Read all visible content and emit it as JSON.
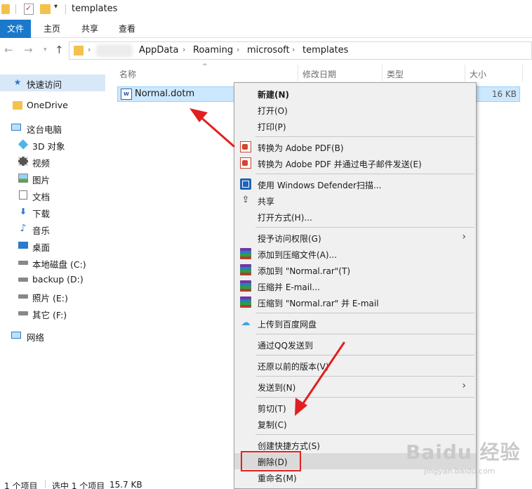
{
  "window": {
    "title": "templates"
  },
  "ribbon": {
    "tabs": [
      "文件",
      "主页",
      "共享",
      "查看"
    ]
  },
  "address": {
    "crumbs": [
      "AppData",
      "Roaming",
      "microsoft",
      "templates"
    ],
    "separator": "›"
  },
  "nav_pane": {
    "items": [
      {
        "label": "快速访问",
        "icon": "star-icon",
        "selected": true
      },
      {
        "label": "OneDrive",
        "icon": "folder-icon"
      },
      {
        "label": "这台电脑",
        "icon": "computer-icon"
      },
      {
        "label": "3D 对象",
        "icon": "cube-icon"
      },
      {
        "label": "视频",
        "icon": "film-icon"
      },
      {
        "label": "图片",
        "icon": "picture-icon"
      },
      {
        "label": "文档",
        "icon": "document-icon"
      },
      {
        "label": "下载",
        "icon": "download-icon"
      },
      {
        "label": "音乐",
        "icon": "music-icon"
      },
      {
        "label": "桌面",
        "icon": "desktop-icon"
      },
      {
        "label": "本地磁盘 (C:)",
        "icon": "drive-icon"
      },
      {
        "label": "backup (D:)",
        "icon": "drive-icon"
      },
      {
        "label": "照片 (E:)",
        "icon": "drive-icon"
      },
      {
        "label": "其它 (F:)",
        "icon": "drive-icon"
      },
      {
        "label": "网络",
        "icon": "network-icon"
      }
    ]
  },
  "columns": {
    "name": "名称",
    "modified": "修改日期",
    "type": "类型",
    "size": "大小"
  },
  "file": {
    "name": "Normal.dotm",
    "size": "16 KB",
    "icon_text": "W"
  },
  "context_menu": {
    "new": "新建(N)",
    "open": "打开(O)",
    "print": "打印(P)",
    "to_pdf": "转换为 Adobe PDF(B)",
    "to_pdf_email": "转换为 Adobe PDF 并通过电子邮件发送(E)",
    "defender": "使用 Windows Defender扫描...",
    "share": "共享",
    "open_with": "打开方式(H)...",
    "grant_access": "授予访问权限(G)",
    "add_archive": "添加到压缩文件(A)...",
    "add_rar": "添加到 \"Normal.rar\"(T)",
    "compress_email": "压缩并 E-mail...",
    "compress_rar_email": "压缩到 \"Normal.rar\" 并 E-mail",
    "baidu_upload": "上传到百度网盘",
    "qq_send": "通过QQ发送到",
    "restore": "还原以前的版本(V)",
    "send_to": "发送到(N)",
    "cut": "剪切(T)",
    "copy": "复制(C)",
    "create_shortcut": "创建快捷方式(S)",
    "delete": "删除(D)",
    "rename": "重命名(M)"
  },
  "status": {
    "count": "1 个项目",
    "selected": "选中 1 个项目",
    "size": "15.7 KB"
  },
  "watermark": {
    "main": "Baidu 经验",
    "sub": "jingyan.baidu.com"
  },
  "colors": {
    "accent": "#1979ca",
    "selection": "#cce8ff",
    "annotation": "#e02020"
  }
}
